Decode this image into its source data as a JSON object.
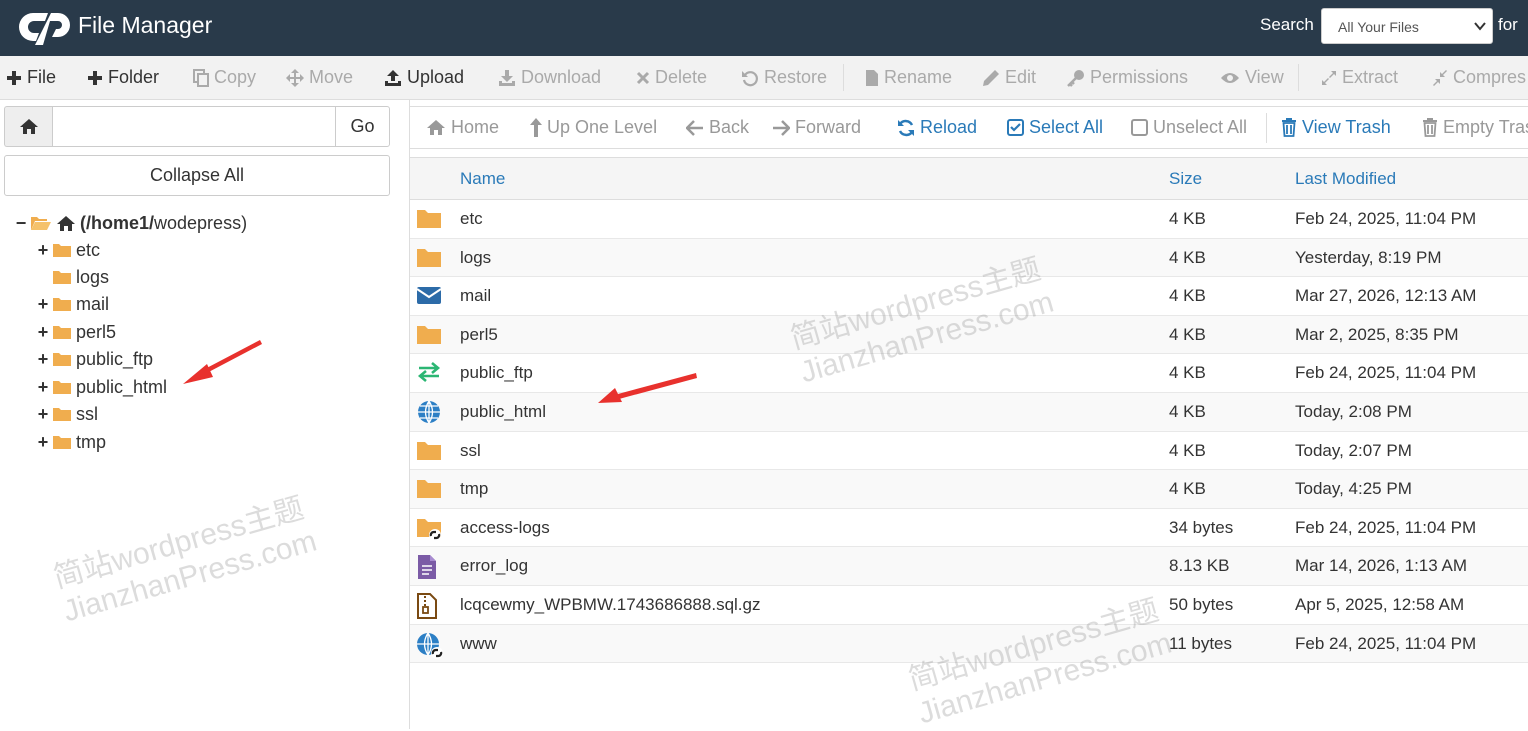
{
  "header": {
    "title": "File Manager",
    "search_label": "Search",
    "search_scope": "All Your Files",
    "for_label": "for"
  },
  "toolbar": {
    "file": "File",
    "folder": "Folder",
    "copy": "Copy",
    "move": "Move",
    "upload": "Upload",
    "download": "Download",
    "delete": "Delete",
    "restore": "Restore",
    "rename": "Rename",
    "edit": "Edit",
    "permissions": "Permissions",
    "view": "View",
    "extract": "Extract",
    "compress": "Compres"
  },
  "sidebar": {
    "path_value": "",
    "go": "Go",
    "collapse_all": "Collapse All",
    "root_label": "(/home1/",
    "root_user": "wodepress)",
    "items": [
      {
        "label": "etc"
      },
      {
        "label": "logs"
      },
      {
        "label": "mail"
      },
      {
        "label": "perl5"
      },
      {
        "label": "public_ftp"
      },
      {
        "label": "public_html"
      },
      {
        "label": "ssl"
      },
      {
        "label": "tmp"
      }
    ]
  },
  "navbar": {
    "home": "Home",
    "up": "Up One Level",
    "back": "Back",
    "forward": "Forward",
    "reload": "Reload",
    "select_all": "Select All",
    "unselect_all": "Unselect All",
    "view_trash": "View Trash",
    "empty_trash": "Empty Tras"
  },
  "table": {
    "headers": {
      "name": "Name",
      "size": "Size",
      "modified": "Last Modified"
    },
    "rows": [
      {
        "icon": "folder-icon",
        "name": "etc",
        "size": "4 KB",
        "modified": "Feb 24, 2025, 11:04 PM"
      },
      {
        "icon": "folder-icon",
        "name": "logs",
        "size": "4 KB",
        "modified": "Yesterday, 8:19 PM"
      },
      {
        "icon": "mail-icon",
        "name": "mail",
        "size": "4 KB",
        "modified": "Mar 27, 2026, 12:13 AM"
      },
      {
        "icon": "folder-icon",
        "name": "perl5",
        "size": "4 KB",
        "modified": "Mar 2, 2025, 8:35 PM"
      },
      {
        "icon": "transfer-icon",
        "name": "public_ftp",
        "size": "4 KB",
        "modified": "Feb 24, 2025, 11:04 PM"
      },
      {
        "icon": "globe-icon",
        "name": "public_html",
        "size": "4 KB",
        "modified": "Today, 2:08 PM"
      },
      {
        "icon": "folder-icon",
        "name": "ssl",
        "size": "4 KB",
        "modified": "Today, 2:07 PM"
      },
      {
        "icon": "folder-icon",
        "name": "tmp",
        "size": "4 KB",
        "modified": "Today, 4:25 PM"
      },
      {
        "icon": "folder-link-icon",
        "name": "access-logs",
        "size": "34 bytes",
        "modified": "Feb 24, 2025, 11:04 PM"
      },
      {
        "icon": "text-file-icon",
        "name": "error_log",
        "size": "8.13 KB",
        "modified": "Mar 14, 2026, 1:13 AM"
      },
      {
        "icon": "archive-icon",
        "name": "lcqcewmy_WPBMW.1743686888.sql.gz",
        "size": "50 bytes",
        "modified": "Apr 5, 2025, 12:58 AM"
      },
      {
        "icon": "globe-link-icon",
        "name": "www",
        "size": "11 bytes",
        "modified": "Feb 24, 2025, 11:04 PM"
      }
    ]
  },
  "watermark": {
    "line1": "简站wordpress主题",
    "line2": "JianzhanPress.com"
  },
  "colors": {
    "header_bg": "#293a4a",
    "link_blue": "#2a7ab8",
    "folder_orange": "#f0ad4e",
    "annotation_red": "#e8312d"
  }
}
